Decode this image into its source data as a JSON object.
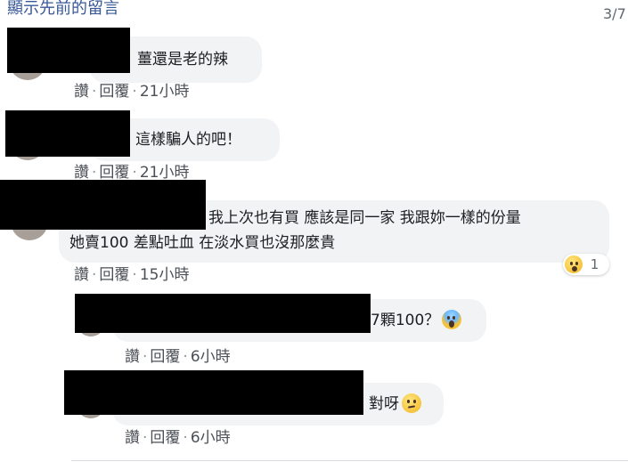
{
  "header": {
    "show_previous": "顯示先前的留言",
    "count": "3/7"
  },
  "comments": [
    {
      "text": "薑還是老的辣",
      "like": "讚",
      "dot": "·",
      "reply": "回覆",
      "time": "21小時"
    },
    {
      "text": "這樣騙人的吧！",
      "like": "讚",
      "dot": "·",
      "reply": "回覆",
      "time": "21小時"
    },
    {
      "text_line1": "我上次也有買 應該是同一家 我跟妳一樣的份量",
      "text_line2": "她賣100 差點吐血 在淡水買也沒那麼貴",
      "like": "讚",
      "dot": "·",
      "reply": "回覆",
      "time": "15小時",
      "reaction": {
        "icon": "astonished-emoji",
        "count": "1"
      }
    },
    {
      "text": "7顆100？",
      "emoji": "scream-emoji",
      "like": "讚",
      "dot": "·",
      "reply": "回覆",
      "time": "6小時"
    },
    {
      "text": "對呀",
      "emoji": "confused-emoji",
      "like": "讚",
      "dot": "·",
      "reply": "回覆",
      "time": "6小時"
    }
  ]
}
